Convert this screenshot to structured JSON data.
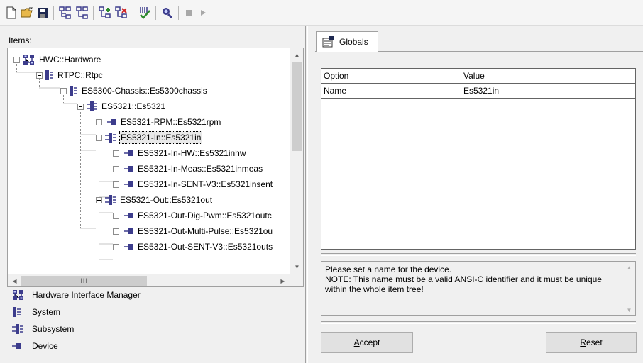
{
  "toolbar": {
    "buttons": [
      "new-icon",
      "open-folder-icon",
      "save-icon",
      "expand-tree-icon",
      "collapse-tree-icon",
      "add-item-icon",
      "remove-item-icon",
      "validate-icon",
      "find-device-icon",
      "stop-icon",
      "run-icon"
    ]
  },
  "left": {
    "items_label": "Items:",
    "tree": [
      {
        "label": "HWC::Hardware",
        "type": "hardware",
        "toggle": "minus"
      },
      {
        "label": "RTPC::Rtpc",
        "type": "system",
        "toggle": "minus"
      },
      {
        "label": "ES5300-Chassis::Es5300chassis",
        "type": "system",
        "toggle": "minus"
      },
      {
        "label": "ES5321::Es5321",
        "type": "subsystem",
        "toggle": "minus"
      },
      {
        "label": "ES5321-RPM::Es5321rpm",
        "type": "device",
        "toggle": "checkbox"
      },
      {
        "label": "ES5321-In::Es5321in",
        "type": "subsystem",
        "toggle": "minus",
        "selected": true
      },
      {
        "label": "ES5321-In-HW::Es5321inhw",
        "type": "device",
        "toggle": "checkbox"
      },
      {
        "label": "ES5321-In-Meas::Es5321inmeas",
        "type": "device",
        "toggle": "checkbox"
      },
      {
        "label": "ES5321-In-SENT-V3::Es5321insent",
        "type": "device",
        "toggle": "checkbox"
      },
      {
        "label": "ES5321-Out::Es5321out",
        "type": "subsystem",
        "toggle": "minus"
      },
      {
        "label": "ES5321-Out-Dig-Pwm::Es5321outc",
        "type": "device",
        "toggle": "checkbox"
      },
      {
        "label": "ES5321-Out-Multi-Pulse::Es5321ou",
        "type": "device",
        "toggle": "checkbox"
      },
      {
        "label": "ES5321-Out-SENT-V3::Es5321outs",
        "type": "device",
        "toggle": "checkbox"
      }
    ],
    "hscroll_grip": "III",
    "legend": [
      {
        "label": "Hardware Interface Manager",
        "icon": "hardware-icon"
      },
      {
        "label": "System",
        "icon": "system-icon"
      },
      {
        "label": "Subsystem",
        "icon": "subsystem-icon"
      },
      {
        "label": "Device",
        "icon": "device-icon"
      }
    ]
  },
  "right": {
    "tab_label": "Globals",
    "grid": {
      "headers": [
        "Option",
        "Value"
      ],
      "rows": [
        [
          "Name",
          "Es5321in"
        ]
      ]
    },
    "description": "Please set a name for the device.\nNOTE: This name must be a valid ANSI-C identifier and it must be unique within the whole item tree!",
    "accept_label": "Accept",
    "reset_label": "Reset"
  },
  "colors": {
    "icon_blue": "#3c3c8c",
    "icon_green": "#2e8b2e",
    "background": "#f0f0f0"
  }
}
